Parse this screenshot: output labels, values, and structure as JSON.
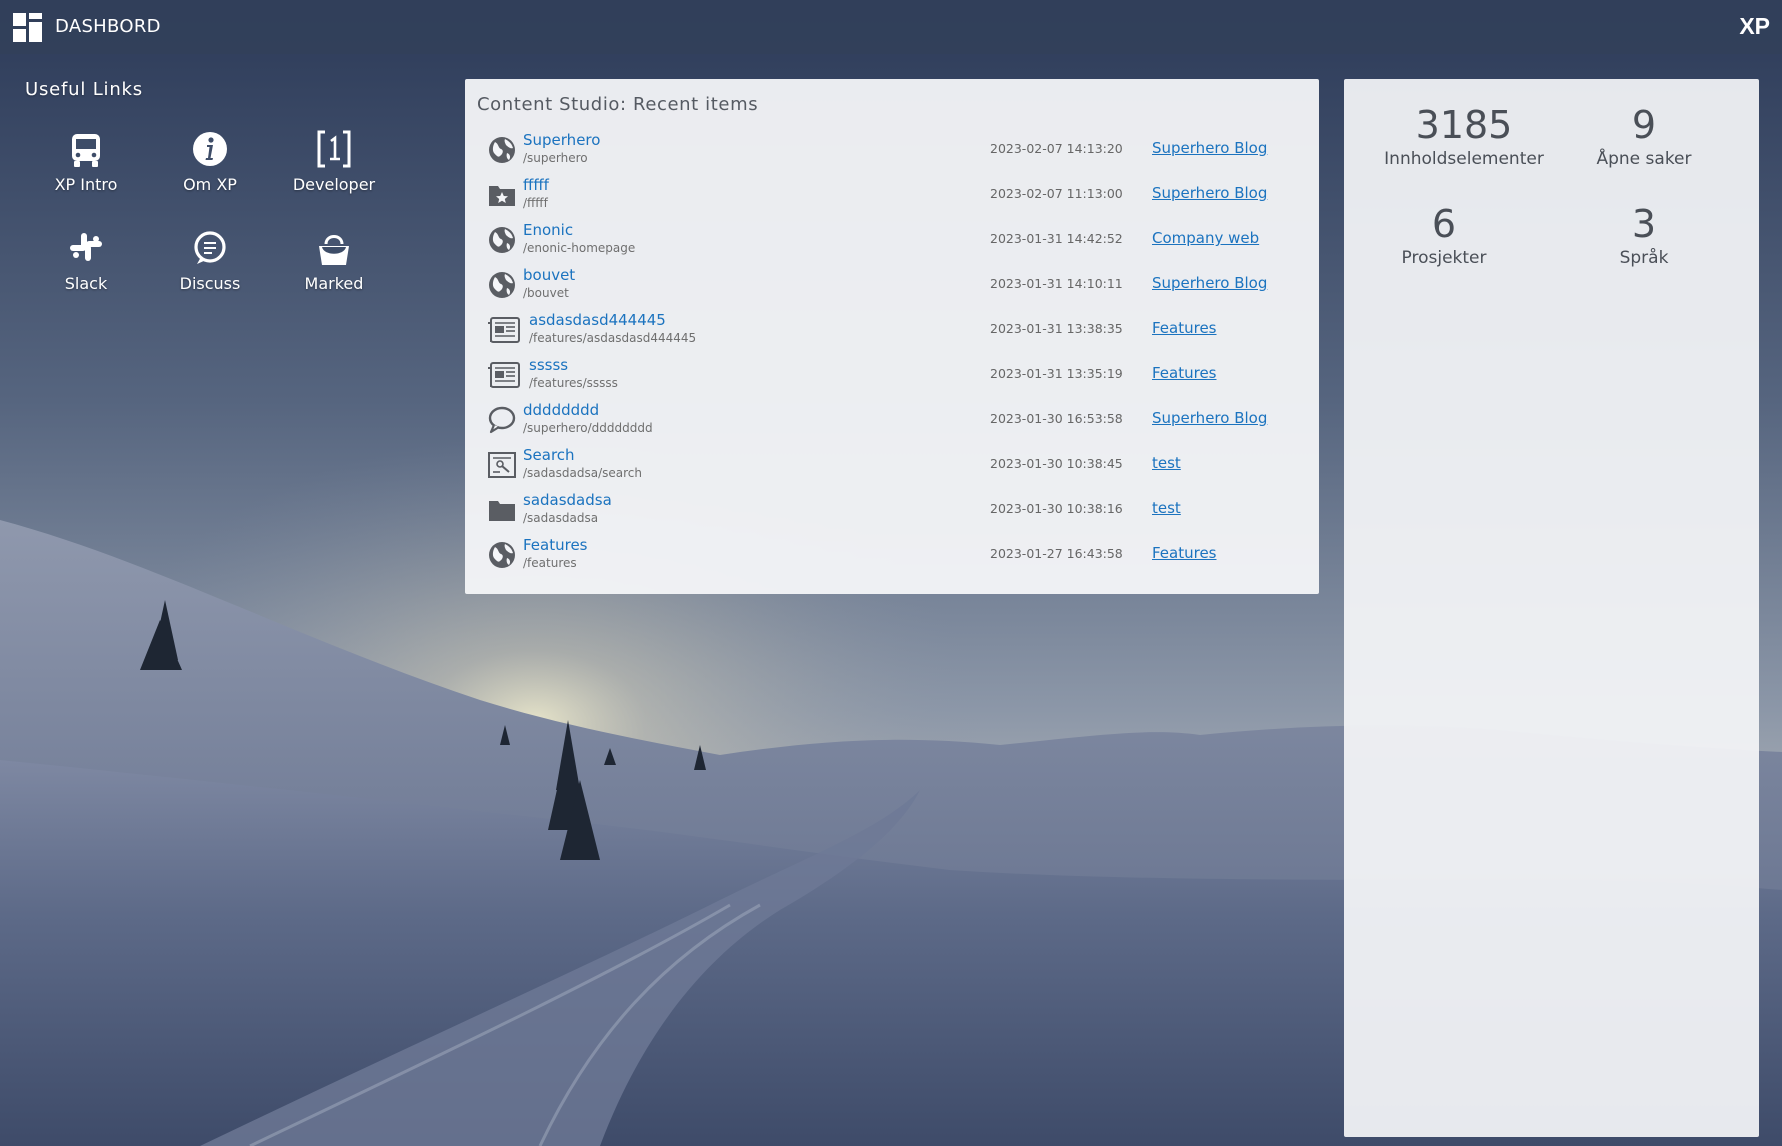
{
  "header": {
    "title": "DASHBORD",
    "brand": "XP",
    "logo_icon": "dashboard-grid-icon"
  },
  "useful_links": {
    "title": "Useful Links",
    "items": [
      {
        "label": "XP Intro",
        "icon": "bus-icon"
      },
      {
        "label": "Om XP",
        "icon": "info-icon"
      },
      {
        "label": "Developer",
        "icon": "bracket-one-icon"
      },
      {
        "label": "Slack",
        "icon": "slack-icon"
      },
      {
        "label": "Discuss",
        "icon": "chat-icon"
      },
      {
        "label": "Marked",
        "icon": "shopping-bag-icon"
      }
    ]
  },
  "recent": {
    "title": "Content Studio: Recent items",
    "items": [
      {
        "name": "Superhero",
        "path": "/superhero",
        "date": "2023-02-07 14:13:20",
        "project": "Superhero Blog",
        "icon": "globe-icon"
      },
      {
        "name": "fffff",
        "path": "/fffff",
        "date": "2023-02-07 11:13:00",
        "project": "Superhero Blog",
        "icon": "folder-star-icon"
      },
      {
        "name": "Enonic",
        "path": "/enonic-homepage",
        "date": "2023-01-31 14:42:52",
        "project": "Company web",
        "icon": "globe-icon"
      },
      {
        "name": "bouvet",
        "path": "/bouvet",
        "date": "2023-01-31 14:10:11",
        "project": "Superhero Blog",
        "icon": "globe-icon"
      },
      {
        "name": "asdasdasd444445",
        "path": "/features/asdasdasd444445",
        "date": "2023-01-31 13:38:35",
        "project": "Features",
        "icon": "article-icon"
      },
      {
        "name": "sssss",
        "path": "/features/sssss",
        "date": "2023-01-31 13:35:19",
        "project": "Features",
        "icon": "article-icon"
      },
      {
        "name": "dddddddd",
        "path": "/superhero/dddddddd",
        "date": "2023-01-30 16:53:58",
        "project": "Superhero Blog",
        "icon": "comment-icon"
      },
      {
        "name": "Search",
        "path": "/sadasdadsa/search",
        "date": "2023-01-30 10:38:45",
        "project": "test",
        "icon": "search-page-icon"
      },
      {
        "name": "sadasdadsa",
        "path": "/sadasdadsa",
        "date": "2023-01-30 10:38:16",
        "project": "test",
        "icon": "folder-icon"
      },
      {
        "name": "Features",
        "path": "/features",
        "date": "2023-01-27 16:43:58",
        "project": "Features",
        "icon": "globe-icon"
      }
    ]
  },
  "stats": [
    {
      "value": "3185",
      "label": "Innholdselementer"
    },
    {
      "value": "9",
      "label": "Åpne saker"
    },
    {
      "value": "6",
      "label": "Prosjekter"
    },
    {
      "value": "3",
      "label": "Språk"
    }
  ],
  "colors": {
    "link": "#1b73bf",
    "topbar": "#32405a",
    "panel": "#f4f5f8",
    "text_dark": "#4a4f57"
  }
}
